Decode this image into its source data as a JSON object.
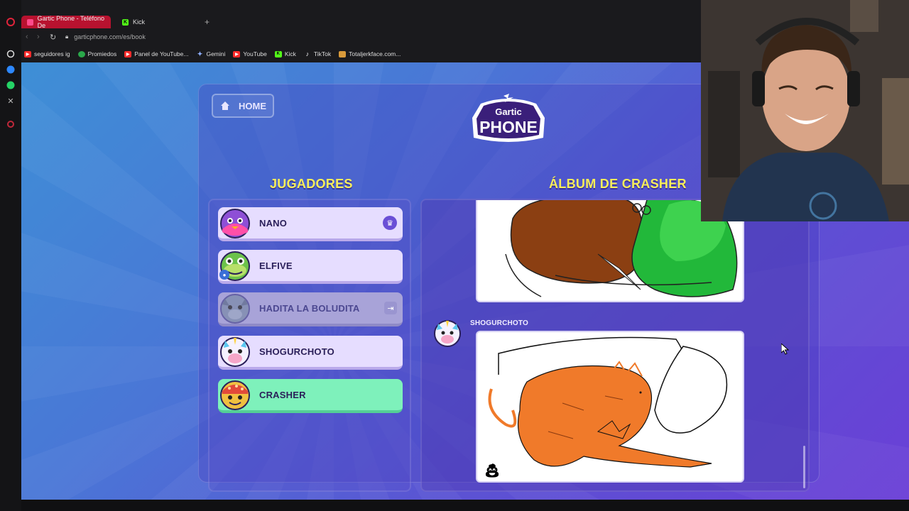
{
  "browser": {
    "tabs": [
      {
        "title": "Gartic Phone - Teléfono De",
        "active": true,
        "favicon_color": "#ff4a8b"
      },
      {
        "title": "Kick",
        "active": false,
        "favicon_color": "#53fc18"
      }
    ],
    "new_tab_label": "+",
    "url": "garticphone.com/es/book",
    "bookmarks": [
      {
        "label": "seguidores ig",
        "color": "#ff2a2a"
      },
      {
        "label": "Promiedos",
        "color": "#2aa84a"
      },
      {
        "label": "Panel de YouTube...",
        "color": "#ff2a2a"
      },
      {
        "label": "Gemini",
        "color": "#6b8cff"
      },
      {
        "label": "YouTube",
        "color": "#ff2a2a"
      },
      {
        "label": "Kick",
        "color": "#53fc18"
      },
      {
        "label": "TikTok",
        "color": "#222222"
      },
      {
        "label": "Totaljerkface.com...",
        "color": "#d89a3a"
      }
    ]
  },
  "game": {
    "home_label": "HOME",
    "logo_top": "Gartic",
    "logo_bottom": "PHONE",
    "players_title": "JUGADORES",
    "album_title": "ÁLBUM DE CRASHER",
    "players": [
      {
        "name": "NANO",
        "state": "host",
        "badge_icon": "crown-icon",
        "avatar_color": "#8e4fd6"
      },
      {
        "name": "ELFIVE",
        "state": "normal",
        "badge_icon": "user-icon",
        "avatar_color": "#6cc24a"
      },
      {
        "name": "HADITA LA BOLUDITA",
        "state": "left",
        "badge_icon": "exit-icon",
        "avatar_color": "#7a8aa8"
      },
      {
        "name": "SHOGURCHOTO",
        "state": "normal",
        "badge_icon": "",
        "avatar_color": "#f2f2f2"
      },
      {
        "name": "CRASHER",
        "state": "self",
        "badge_icon": "",
        "avatar_color": "#f0c040"
      }
    ],
    "album": {
      "entries": [
        {
          "author": "",
          "kind": "drawing",
          "description_icon": "drawing-canvas"
        },
        {
          "author": "SHOGURCHOTO",
          "kind": "drawing",
          "description_icon": "drawing-canvas"
        }
      ]
    }
  }
}
